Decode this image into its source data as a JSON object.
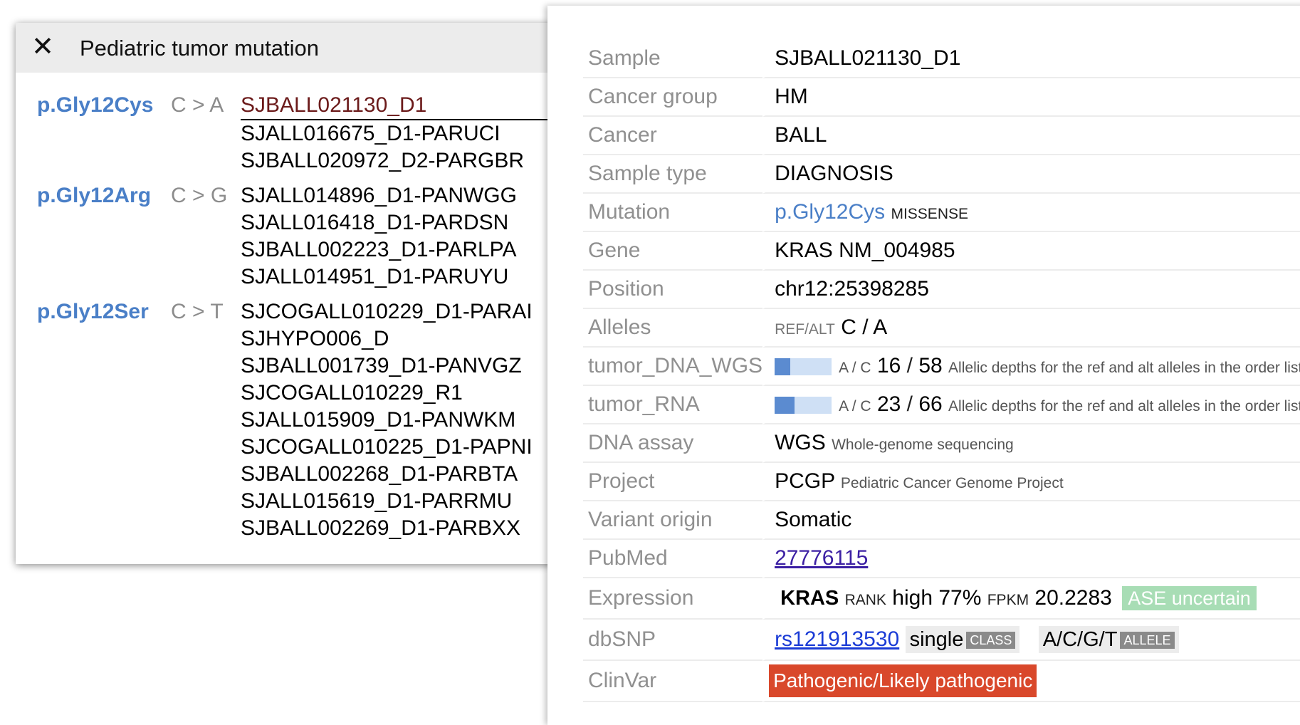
{
  "left_panel": {
    "close_glyph": "✕",
    "title": "Pediatric tumor mutation",
    "groups": [
      {
        "mutation": "p.Gly12Cys",
        "change": "C > A",
        "samples": [
          "SJBALL021130_D1",
          "SJALL016675_D1-PARUCI",
          "SJBALL020972_D2-PARGBR"
        ]
      },
      {
        "mutation": "p.Gly12Arg",
        "change": "C > G",
        "samples": [
          "SJALL014896_D1-PANWGG",
          "SJALL016418_D1-PARDSN",
          "SJBALL002223_D1-PARLPA",
          "SJALL014951_D1-PARUYU"
        ]
      },
      {
        "mutation": "p.Gly12Ser",
        "change": "C > T",
        "samples": [
          "SJCOGALL010229_D1-PARAI",
          "SJHYPO006_D",
          "SJBALL001739_D1-PANVGZ",
          "SJCOGALL010229_R1",
          "SJALL015909_D1-PANWKM",
          "SJCOGALL010225_D1-PAPNI",
          "SJBALL002268_D1-PARBTA",
          "SJALL015619_D1-PARRMU",
          "SJBALL002269_D1-PARBXX"
        ]
      }
    ]
  },
  "detail": {
    "sample": {
      "label": "Sample",
      "value": "SJBALL021130_D1"
    },
    "cancer_group": {
      "label": "Cancer group",
      "value": "HM"
    },
    "cancer": {
      "label": "Cancer",
      "value": "BALL"
    },
    "sample_type": {
      "label": "Sample type",
      "value": "DIAGNOSIS"
    },
    "mutation": {
      "label": "Mutation",
      "value": "p.Gly12Cys",
      "class": "MISSENSE"
    },
    "gene": {
      "label": "Gene",
      "value": "KRAS NM_004985"
    },
    "position": {
      "label": "Position",
      "value": "chr12:25398285"
    },
    "alleles": {
      "label": "Alleles",
      "prefix": "REF/ALT",
      "value": "C / A"
    },
    "tumor_dna_wgs": {
      "label": "tumor_DNA_WGS",
      "alleles": "A / C",
      "alt": "16",
      "total": "58",
      "fraction": 0.276,
      "desc": "Allelic depths for the ref and alt alleles in the order listed"
    },
    "tumor_rna": {
      "label": "tumor_RNA",
      "alleles": "A / C",
      "alt": "23",
      "total": "66",
      "fraction": 0.348,
      "desc": "Allelic depths for the ref and alt alleles in the order listed"
    },
    "dna_assay": {
      "label": "DNA assay",
      "value": "WGS",
      "desc": "Whole-genome sequencing"
    },
    "project": {
      "label": "Project",
      "value": "PCGP",
      "desc": "Pediatric Cancer Genome Project"
    },
    "variant_origin": {
      "label": "Variant origin",
      "value": "Somatic"
    },
    "pubmed": {
      "label": "PubMed",
      "value": "27776115"
    },
    "expression": {
      "label": "Expression",
      "gene": "KRAS",
      "rank_label": "RANK",
      "rank_value": "high 77%",
      "fpkm_label": "FPKM",
      "fpkm_value": "20.2283",
      "ase": "ASE uncertain"
    },
    "dbsnp": {
      "label": "dbSNP",
      "rsid": "rs121913530",
      "class_value": "single",
      "class_label": "CLASS",
      "allele_value": "A/C/G/T",
      "allele_label": "ALLELE"
    },
    "clinvar": {
      "label": "ClinVar",
      "value": "Pathogenic/Likely pathogenic"
    }
  },
  "colors": {
    "mutation_link": "#4a7fc7",
    "clinvar_badge": "#d9482b",
    "ase_badge": "#a8ddb5",
    "bar_fill": "#5b8bd0",
    "bar_bg": "#cfe0f5"
  }
}
